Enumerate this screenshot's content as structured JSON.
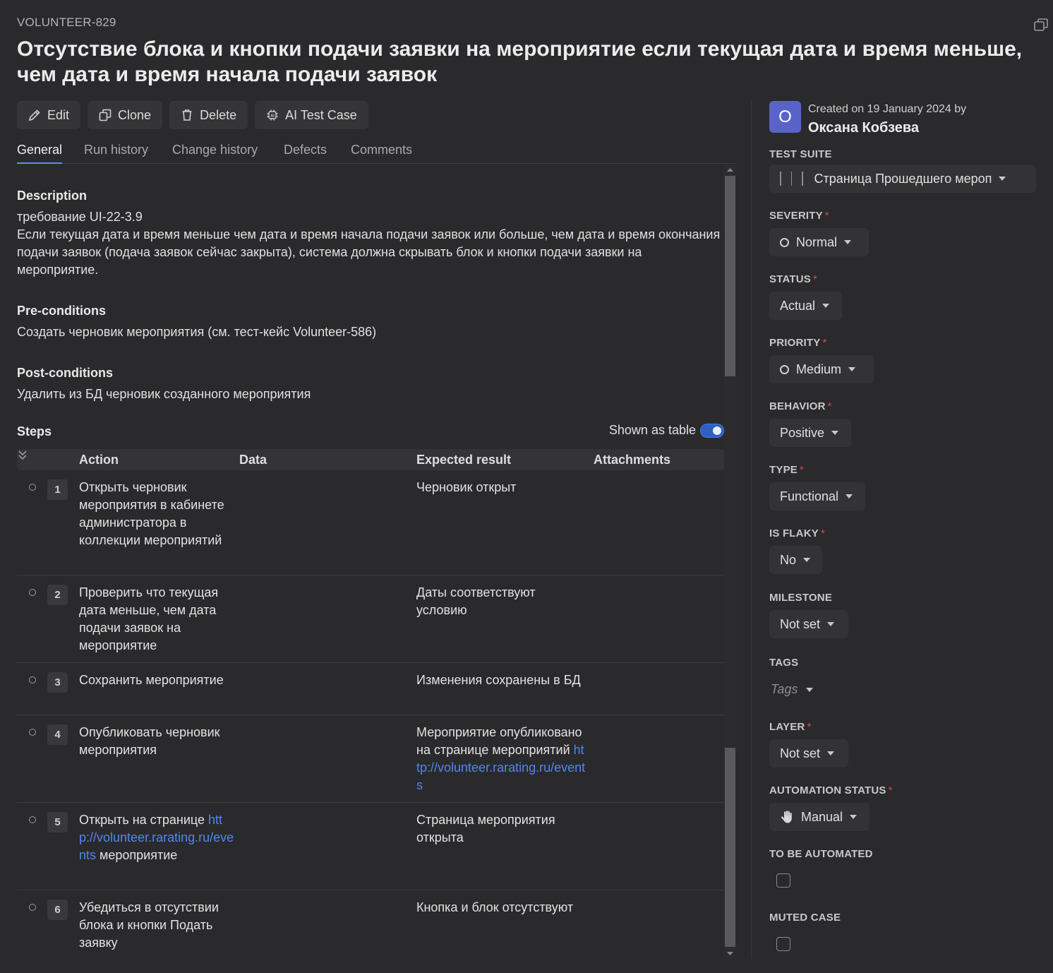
{
  "case_id": "VOLUNTEER-829",
  "title": "Отсутствие блока и кнопки подачи заявки на мероприятие если текущая дата и время меньше, чем дата и время начала подачи заявок",
  "toolbar": {
    "edit_label": "Edit",
    "clone_label": "Clone",
    "delete_label": "Delete",
    "ai_label": "AI Test Case"
  },
  "tabs": [
    "General",
    "Run history",
    "Change history",
    "Defects",
    "Comments"
  ],
  "active_tab": "General",
  "description": {
    "heading": "Description",
    "line1": "требование UI-22-3.9",
    "line2": "Если текущая дата и время меньше чем дата и время начала подачи заявок или больше, чем дата и время окончания подачи заявок (подача заявок сейчас закрыта), система должна скрывать блок и кнопки подачи заявки на мероприятие."
  },
  "preconditions": {
    "heading": "Pre-conditions",
    "text": "Создать черновик мероприятия (см. тест-кейс Volunteer-586)"
  },
  "postconditions": {
    "heading": "Post-conditions",
    "text": "Удалить из БД черновик созданного мероприятия"
  },
  "steps": {
    "heading": "Steps",
    "toggle_label": "Shown as table",
    "toggle_on": true,
    "columns": [
      "Action",
      "Data",
      "Expected result",
      "Attachments"
    ],
    "rows": [
      {
        "num": "1",
        "action": "Открыть черновик мероприятия в кабинете администратора в коллекции мероприятий",
        "expected": "Черновик открыт"
      },
      {
        "num": "2",
        "action": "Проверить что текущая дата меньше, чем дата подачи заявок на мероприятие",
        "expected": "Даты соответствуют условию"
      },
      {
        "num": "3",
        "action": "Сохранить мероприятие",
        "expected": "Изменения сохранены в БД"
      },
      {
        "num": "4",
        "action": "Опубликовать черновик мероприятия",
        "expected_text": "Мероприятие опубликовано на странице мероприятий ",
        "expected_link": "http://volunteer.rarating.ru/events"
      },
      {
        "num": "5",
        "action_pre": "Открыть на странице ",
        "action_link": "http://volunteer.rarating.ru/events",
        "action_post": " мероприятие",
        "expected": "Страница мероприятия открыта"
      },
      {
        "num": "6",
        "action": "Убедиться в отсутствии блока и кнопки Подать заявку",
        "expected": "Кнопка и блок отсутствуют"
      }
    ]
  },
  "sidebar": {
    "avatar_letter": "O",
    "created_text": "Created on 19 January 2024 by",
    "author": "Оксана Кобзева",
    "test_suite_label": "TEST SUITE",
    "test_suite_value": "Страница Прошедшего мероп",
    "severity_label": "SEVERITY",
    "severity_value": "Normal",
    "status_label": "STATUS",
    "status_value": "Actual",
    "priority_label": "PRIORITY",
    "priority_value": "Medium",
    "behavior_label": "BEHAVIOR",
    "behavior_value": "Positive",
    "type_label": "TYPE",
    "type_value": "Functional",
    "is_flaky_label": "IS FLAKY",
    "is_flaky_value": "No",
    "milestone_label": "MILESTONE",
    "milestone_value": "Not set",
    "tags_label": "TAGS",
    "tags_placeholder": "Tags",
    "layer_label": "LAYER",
    "layer_value": "Not set",
    "automation_label": "AUTOMATION STATUS",
    "automation_value": "Manual",
    "to_be_automated_label": "TO BE AUTOMATED",
    "to_be_automated_checked": false,
    "muted_label": "MUTED CASE",
    "muted_checked": false,
    "required_mark": "*"
  },
  "colors": {
    "background": "#2a2a2c",
    "accent": "#5b8def",
    "link": "#4f86f0",
    "avatar": "#5a63c9",
    "required": "#d24a4a"
  }
}
